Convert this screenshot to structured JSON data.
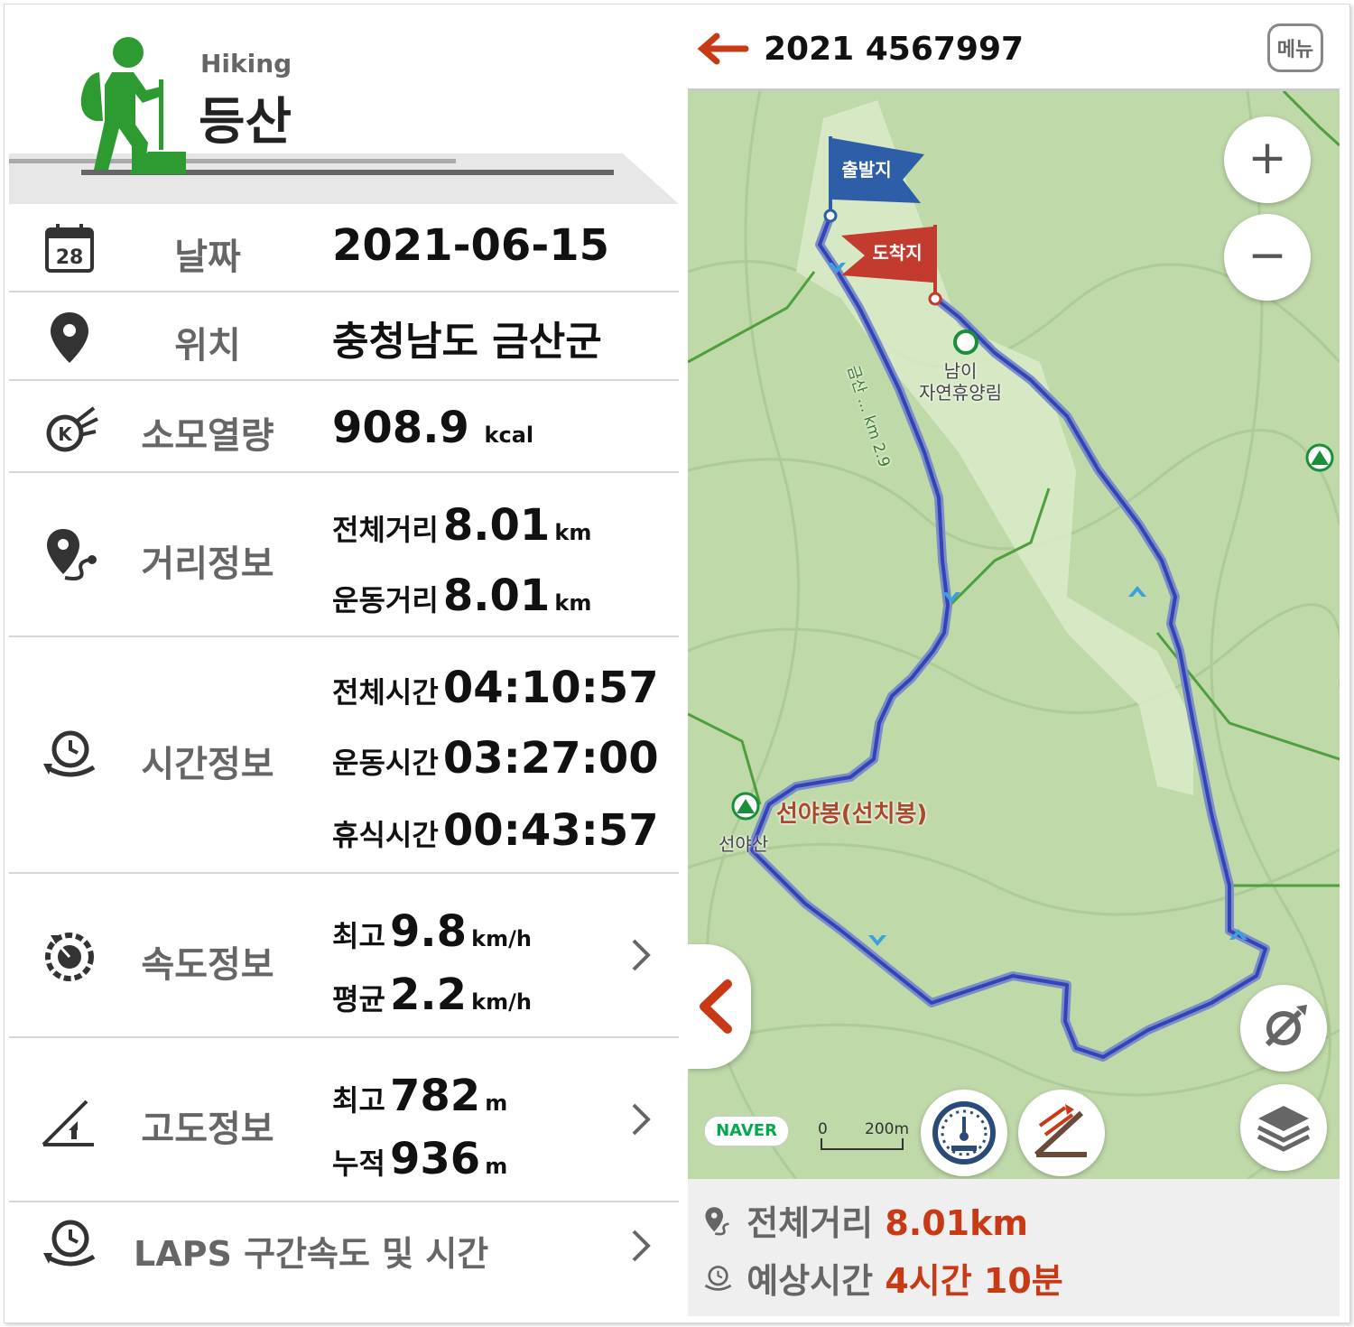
{
  "header": {
    "sub_title": "Hiking",
    "title": "등산"
  },
  "rows": {
    "date": {
      "icon": "calendar-icon",
      "calendar_day": "28",
      "label": "날짜",
      "value": "2021-06-15"
    },
    "location": {
      "icon": "location-pin-icon",
      "label": "위치",
      "value": "충청남도 금산군"
    },
    "calories": {
      "icon": "calorie-fire-icon",
      "label": "소모열량",
      "value": "908.9",
      "unit": "kcal"
    },
    "distance": {
      "icon": "distance-route-icon",
      "label": "거리정보",
      "total_label": "전체거리",
      "total_value": "8.01",
      "total_unit": "km",
      "move_label": "운동거리",
      "move_value": "8.01",
      "move_unit": "km"
    },
    "time": {
      "icon": "time-clock-icon",
      "label": "시간정보",
      "total_label": "전체시간",
      "total_value": "04:10:57",
      "move_label": "운동시간",
      "move_value": "03:27:00",
      "rest_label": "휴식시간",
      "rest_value": "00:43:57"
    },
    "speed": {
      "icon": "speedometer-icon",
      "label": "속도정보",
      "max_label": "최고",
      "max_value": "9.8",
      "max_unit": "km/h",
      "avg_label": "평균",
      "avg_value": "2.2",
      "avg_unit": "km/h"
    },
    "altitude": {
      "icon": "altitude-slope-icon",
      "label": "고도정보",
      "max_label": "최고",
      "max_value": "782",
      "max_unit": "m",
      "acc_label": "누적",
      "acc_value": "936",
      "acc_unit": "m"
    },
    "laps": {
      "icon": "lap-timer-icon",
      "label": "LAPS 구간속도 및 시간"
    }
  },
  "map_panel": {
    "title": "2021 4567997",
    "menu_label": "메뉴",
    "start_flag": "출발지",
    "end_flag": "도착지",
    "poi_peak": "선야봉(선치봉)",
    "poi_peak_sub": "선야산",
    "poi_forest": "남이\n자연휴양림",
    "trail_label": "금산 ... km 2.9",
    "naver": "NAVER",
    "scale_zero": "0",
    "scale_dist": "200m",
    "zoom_in": "+",
    "zoom_out": "−",
    "bottom": {
      "distance_label": "전체거리",
      "distance_value": "8.01km",
      "eta_label": "예상시간",
      "eta_value": "4시간 10분"
    },
    "colors": {
      "accent": "#c83a16",
      "route": "#3344b8",
      "start_flag": "#2f5ea8",
      "end_flag": "#c33a2e",
      "map_bg": "#bfd9a9"
    }
  }
}
